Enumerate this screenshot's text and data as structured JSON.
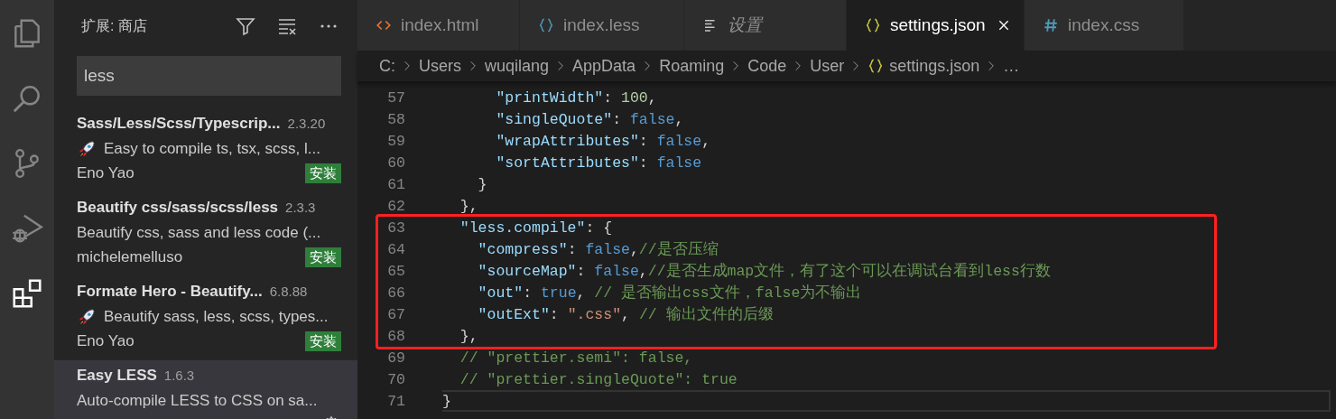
{
  "activity_bar": [
    {
      "kind": "files",
      "selected": false
    },
    {
      "kind": "search",
      "selected": false
    },
    {
      "kind": "scm",
      "selected": false
    },
    {
      "kind": "debug",
      "selected": false
    },
    {
      "kind": "extensions",
      "selected": true
    }
  ],
  "sidebar": {
    "title": "扩展: 商店",
    "search": {
      "value": "less"
    },
    "extensions": [
      {
        "name": "Sass/Less/Scss/Typescrip...",
        "version": "2.3.20",
        "rocket": true,
        "description": "Easy to compile ts, tsx, scss, l...",
        "publisher": "Eno Yao",
        "action": "安装",
        "selected": false
      },
      {
        "name": "Beautify css/sass/scss/less",
        "version": "2.3.3",
        "rocket": false,
        "description": "Beautify css, sass and less code (...",
        "publisher": "michelemelluso",
        "action": "安装",
        "selected": false
      },
      {
        "name": "Formate Hero - Beautify...",
        "version": "6.8.88",
        "rocket": true,
        "description": "Beautify sass, less, scss, types...",
        "publisher": "Eno Yao",
        "action": "安装",
        "selected": false
      },
      {
        "name": "Easy LESS",
        "version": "1.6.3",
        "rocket": false,
        "description": "Auto-compile LESS to CSS on sa...",
        "installed": true,
        "selected": true
      }
    ]
  },
  "tabs": [
    {
      "label": "index.html",
      "kind": "html",
      "preview": false,
      "selected": false
    },
    {
      "label": "index.less",
      "kind": "braces",
      "preview": false,
      "selected": false
    },
    {
      "label": "设置",
      "kind": "settings",
      "preview": true,
      "selected": false
    },
    {
      "label": "settings.json",
      "kind": "braces",
      "preview": false,
      "selected": true
    },
    {
      "label": "index.css",
      "kind": "css",
      "preview": false,
      "selected": false
    }
  ],
  "breadcrumbs": [
    {
      "label": "C:",
      "kind": "folder"
    },
    {
      "label": "Users",
      "kind": "folder"
    },
    {
      "label": "wuqilang",
      "kind": "folder"
    },
    {
      "label": "AppData",
      "kind": "folder"
    },
    {
      "label": "Roaming",
      "kind": "folder"
    },
    {
      "label": "Code",
      "kind": "folder"
    },
    {
      "label": "User",
      "kind": "folder"
    },
    {
      "label": "settings.json",
      "kind": "json"
    },
    {
      "label": "…",
      "kind": "more"
    }
  ],
  "code": {
    "blocks": [
      {
        "boxed": false,
        "lines": [
          {
            "number": "57",
            "current": false,
            "tokens": [
              {
                "kind": "key",
                "text": "      \"printWidth\""
              },
              {
                "kind": "punct",
                "text": ": "
              },
              {
                "kind": "num",
                "text": "100"
              },
              {
                "kind": "punct",
                "text": ","
              }
            ]
          },
          {
            "number": "58",
            "current": false,
            "tokens": [
              {
                "kind": "key",
                "text": "      \"singleQuote\""
              },
              {
                "kind": "punct",
                "text": ": "
              },
              {
                "kind": "bool",
                "text": "false"
              },
              {
                "kind": "punct",
                "text": ","
              }
            ]
          },
          {
            "number": "59",
            "current": false,
            "tokens": [
              {
                "kind": "key",
                "text": "      \"wrapAttributes\""
              },
              {
                "kind": "punct",
                "text": ": "
              },
              {
                "kind": "bool",
                "text": "false"
              },
              {
                "kind": "punct",
                "text": ","
              }
            ]
          },
          {
            "number": "60",
            "current": false,
            "tokens": [
              {
                "kind": "key",
                "text": "      \"sortAttributes\""
              },
              {
                "kind": "punct",
                "text": ": "
              },
              {
                "kind": "bool",
                "text": "false"
              }
            ]
          },
          {
            "number": "61",
            "current": false,
            "tokens": [
              {
                "kind": "punct",
                "text": "    }"
              }
            ]
          },
          {
            "number": "62",
            "current": false,
            "tokens": [
              {
                "kind": "punct",
                "text": "  },"
              }
            ]
          }
        ]
      },
      {
        "boxed": true,
        "lines": [
          {
            "number": "63",
            "current": false,
            "tokens": [
              {
                "kind": "key",
                "text": "  \"less.compile\""
              },
              {
                "kind": "punct",
                "text": ": {"
              }
            ]
          },
          {
            "number": "64",
            "current": false,
            "tokens": [
              {
                "kind": "key",
                "text": "    \"compress\""
              },
              {
                "kind": "punct",
                "text": ": "
              },
              {
                "kind": "bool",
                "text": "false"
              },
              {
                "kind": "punct",
                "text": ","
              },
              {
                "kind": "comment",
                "text": "//是否压缩"
              }
            ]
          },
          {
            "number": "65",
            "current": false,
            "tokens": [
              {
                "kind": "key",
                "text": "    \"sourceMap\""
              },
              {
                "kind": "punct",
                "text": ": "
              },
              {
                "kind": "bool",
                "text": "false"
              },
              {
                "kind": "punct",
                "text": ","
              },
              {
                "kind": "comment",
                "text": "//是否生成map文件，有了这个可以在调试台看到less行数"
              }
            ]
          },
          {
            "number": "66",
            "current": false,
            "tokens": [
              {
                "kind": "key",
                "text": "    \"out\""
              },
              {
                "kind": "punct",
                "text": ": "
              },
              {
                "kind": "bool",
                "text": "true"
              },
              {
                "kind": "punct",
                "text": ", "
              },
              {
                "kind": "comment",
                "text": "// 是否输出css文件，false为不输出"
              }
            ]
          },
          {
            "number": "67",
            "current": false,
            "tokens": [
              {
                "kind": "key",
                "text": "    \"outExt\""
              },
              {
                "kind": "punct",
                "text": ": "
              },
              {
                "kind": "str",
                "text": "\".css\""
              },
              {
                "kind": "punct",
                "text": ", "
              },
              {
                "kind": "comment",
                "text": "// 输出文件的后缀"
              }
            ]
          },
          {
            "number": "68",
            "current": false,
            "tokens": [
              {
                "kind": "punct",
                "text": "  },"
              }
            ]
          }
        ]
      },
      {
        "boxed": false,
        "lines": [
          {
            "number": "69",
            "current": false,
            "tokens": [
              {
                "kind": "comment",
                "text": "  // \"prettier.semi\": false,"
              }
            ]
          },
          {
            "number": "70",
            "current": false,
            "tokens": [
              {
                "kind": "comment",
                "text": "  // \"prettier.singleQuote\": true"
              }
            ]
          },
          {
            "number": "71",
            "current": true,
            "tokens": [
              {
                "kind": "punct",
                "text": "}"
              }
            ]
          }
        ]
      }
    ]
  }
}
